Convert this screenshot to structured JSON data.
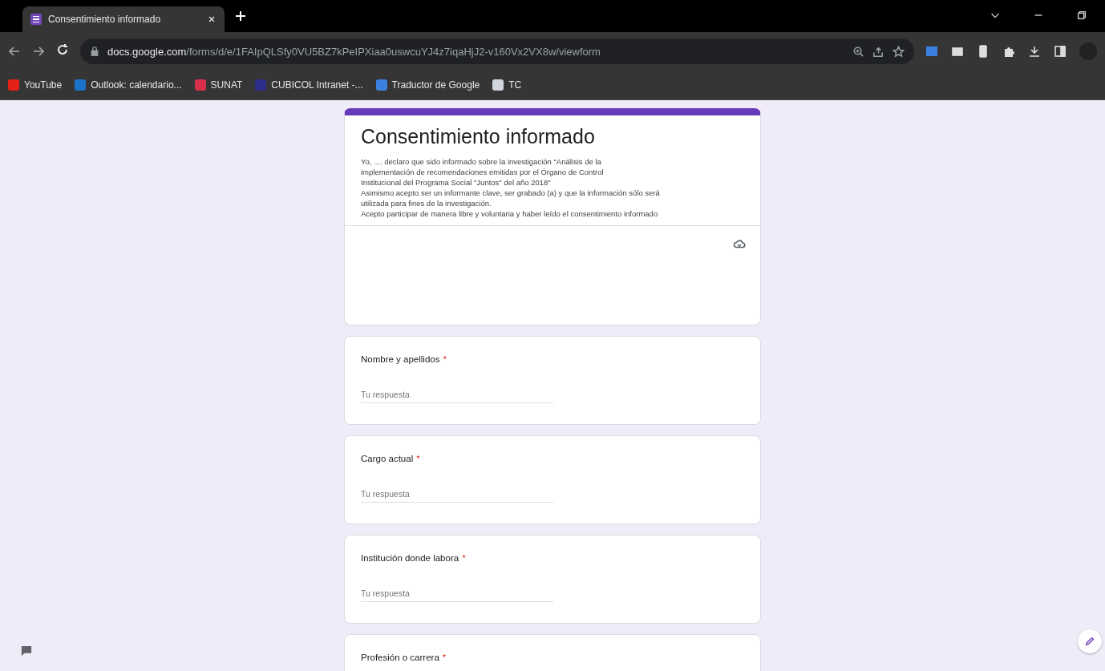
{
  "browser": {
    "tab": {
      "title": "Consentimiento informado",
      "selected": true
    },
    "url": {
      "host": "docs.google.com",
      "path": "/forms/d/e/1FAIpQLSfy0VU5BZ7kPeIPXiaa0uswcuYJ4z7iqaHjJ2-v160Vx2VX8w/viewform"
    },
    "bookmarks": [
      {
        "label": "YouTube",
        "color": "#e62117"
      },
      {
        "label": "Outlook: calendario...",
        "color": "#1a73c8"
      },
      {
        "label": "SUNAT",
        "color": "#d8304a"
      },
      {
        "label": "CUBICOL Intranet -...",
        "color": "#2c2f8a"
      },
      {
        "label": "Traductor de Google",
        "color": "#3b82e0"
      },
      {
        "label": "TC",
        "color": "#d0d4dc"
      }
    ]
  },
  "form": {
    "title": "Consentimiento informado",
    "description": [
      "Yo, .... declaro que sido informado sobre la investigación \"Análisis de la",
      "implementación de recomendaciones emitidas por el Órgano de Control",
      "Institucional del Programa Social \"Juntos\" del año 2018\"",
      "Asimismo acepto ser un informante clave, ser grabado (a) y que la información sólo será",
      "utilizada para fines de la investigación.",
      "Acepto participar de manera libre y voluntaria y haber leído el consentimiento informado"
    ],
    "questions": [
      {
        "label": "Nombre y apellidos",
        "required": true,
        "required_mark": "*",
        "placeholder": "Tu respuesta"
      },
      {
        "label": "Cargo actual",
        "required": true,
        "required_mark": "*",
        "placeholder": "Tu respuesta"
      },
      {
        "label": "Institución donde labora",
        "required": true,
        "required_mark": "*",
        "placeholder": "Tu respuesta"
      },
      {
        "label": "Profesión o carrera",
        "required": true,
        "required_mark": "*"
      }
    ]
  }
}
